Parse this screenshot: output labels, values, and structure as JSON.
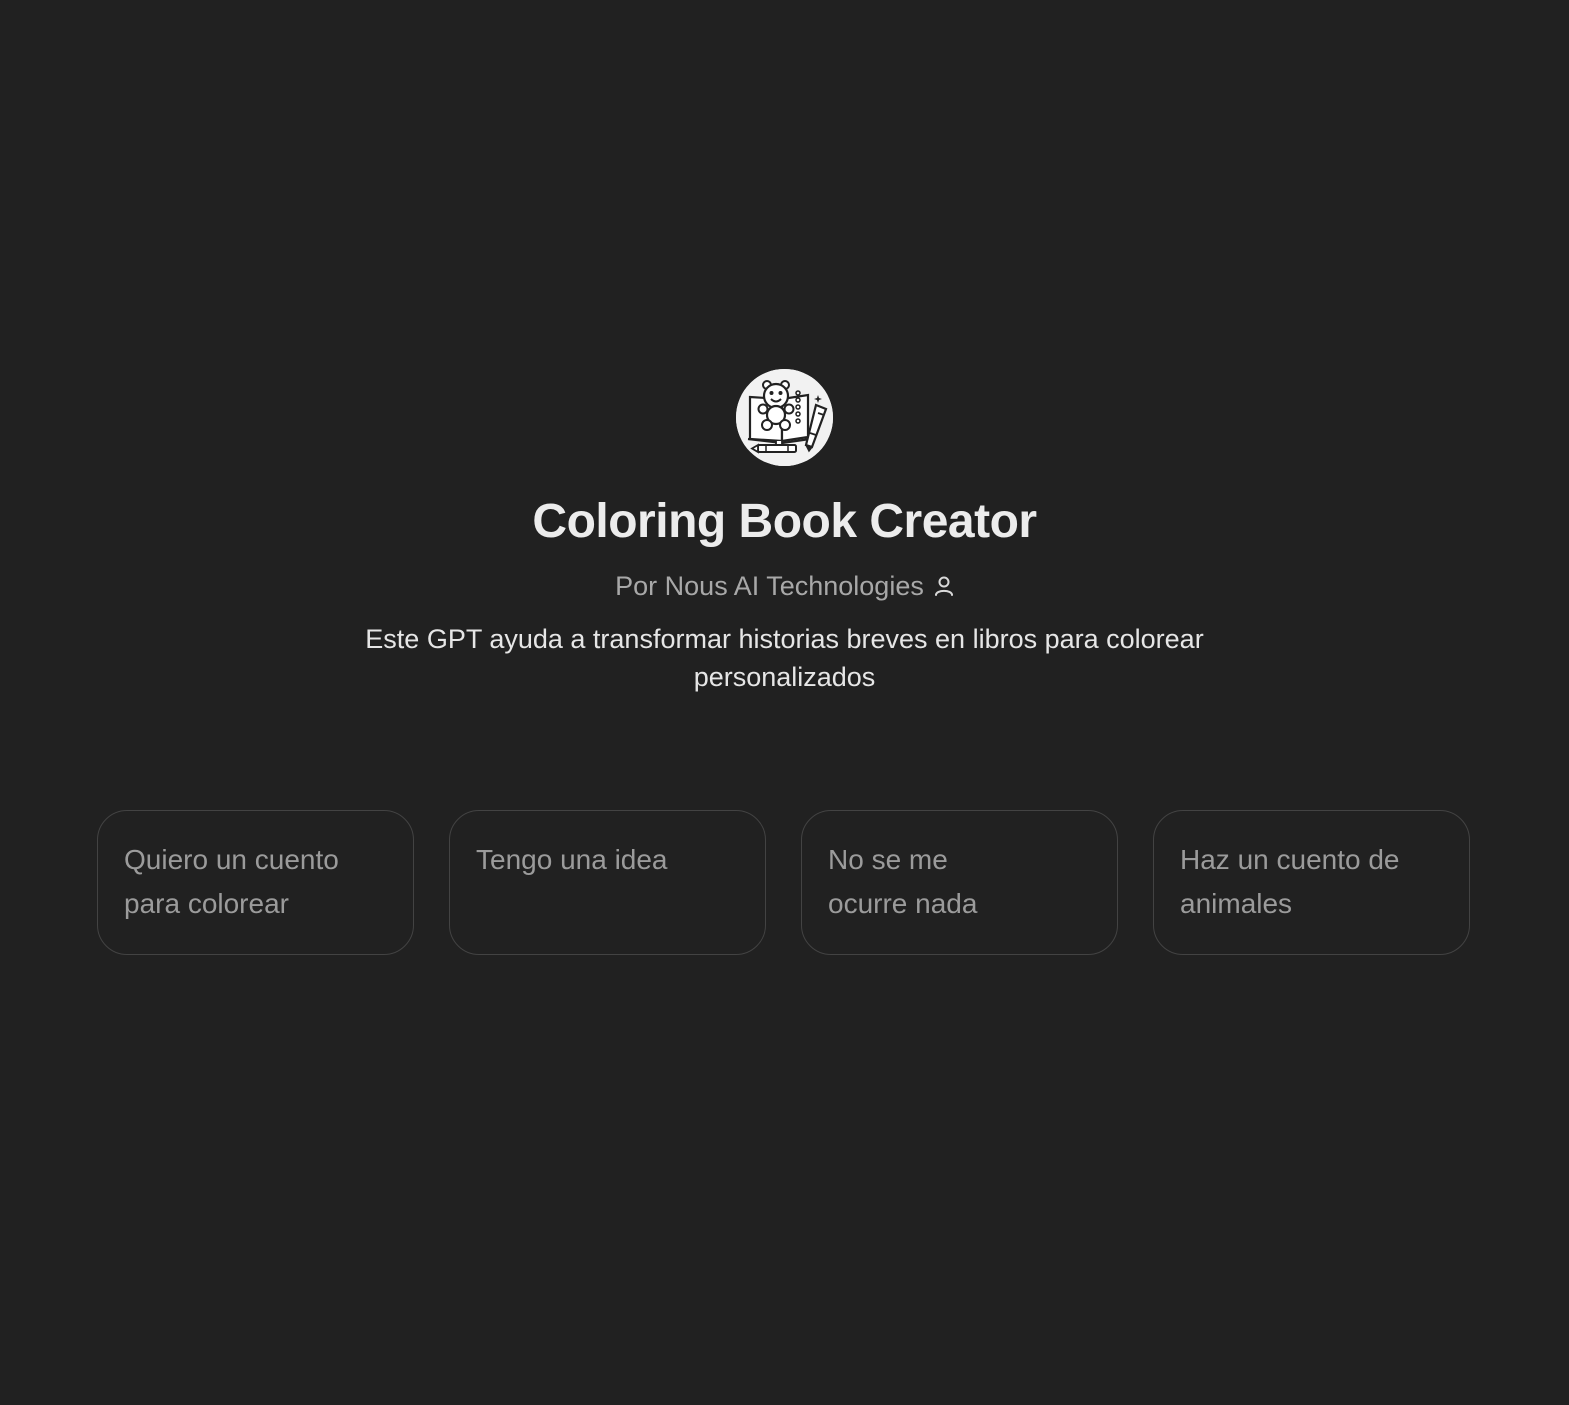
{
  "gpt": {
    "title": "Coloring Book Creator",
    "author": "Por Nous AI Technologies",
    "author_icon": "user-icon",
    "description": "Este GPT ayuda a transformar historias breves en libros para colorear personalizados",
    "avatar_icon": "coloring-book-logo"
  },
  "suggestions": [
    {
      "label": "Quiero un cuento para colorear"
    },
    {
      "label": "Tengo una idea"
    },
    {
      "label": "No se me ocurre nada"
    },
    {
      "label": "Haz un cuento de animales"
    }
  ],
  "colors": {
    "background": "#212121",
    "title": "#ececec",
    "author": "#a8a8a8",
    "card_border": "#434343",
    "card_text": "#9b9b9b"
  }
}
